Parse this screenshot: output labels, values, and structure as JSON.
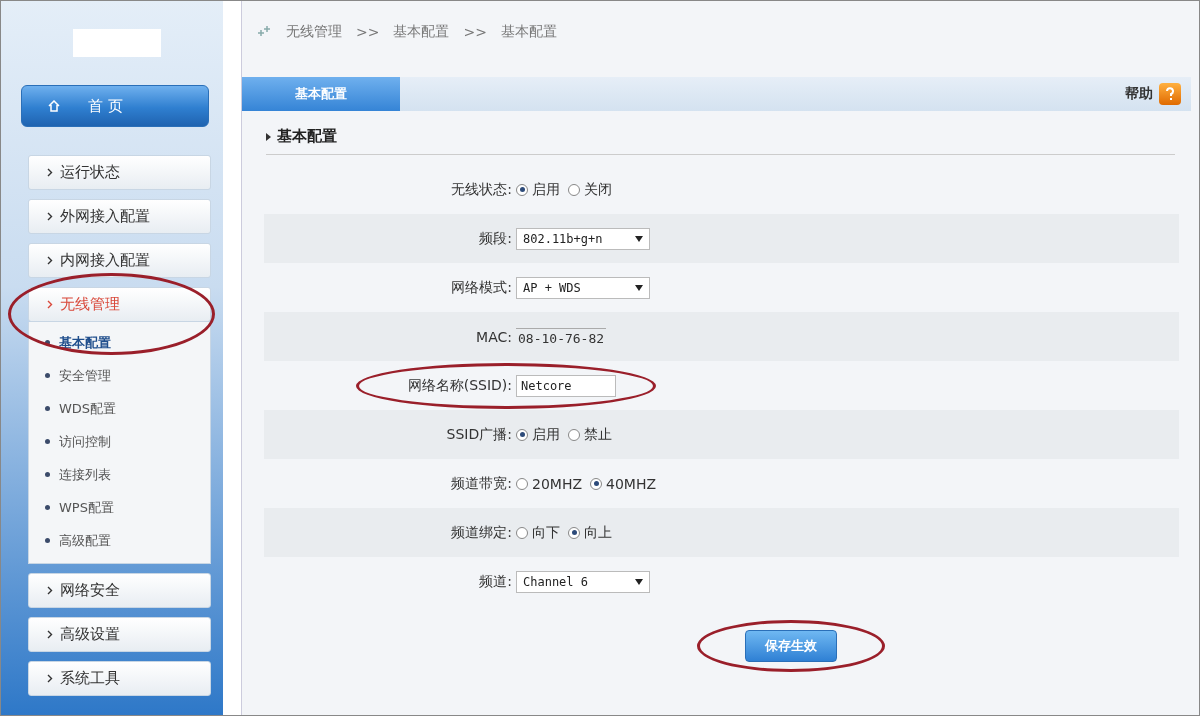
{
  "sidebar": {
    "home": {
      "label": "首 页"
    },
    "items": [
      {
        "label": "运行状态",
        "selected": false
      },
      {
        "label": "外网接入配置",
        "selected": false
      },
      {
        "label": "内网接入配置",
        "selected": false
      },
      {
        "label": "无线管理",
        "selected": true,
        "circled": true,
        "children": [
          {
            "label": "基本配置",
            "selected": true
          },
          {
            "label": "安全管理",
            "selected": false
          },
          {
            "label": "WDS配置",
            "selected": false
          },
          {
            "label": "访问控制",
            "selected": false
          },
          {
            "label": "连接列表",
            "selected": false
          },
          {
            "label": "WPS配置",
            "selected": false
          },
          {
            "label": "高级配置",
            "selected": false
          }
        ]
      },
      {
        "label": "网络安全",
        "selected": false
      },
      {
        "label": "高级设置",
        "selected": false
      },
      {
        "label": "系统工具",
        "selected": false
      }
    ]
  },
  "breadcrumb": {
    "separator": ">>",
    "items": [
      "无线管理",
      "基本配置",
      "基本配置"
    ]
  },
  "tabs": [
    {
      "label": "基本配置",
      "selected": true
    }
  ],
  "help": "帮助",
  "section_title": "基本配置",
  "form": [
    {
      "kind": "radio",
      "label": "无线状态:",
      "options": [
        {
          "label": "启用",
          "selected": true
        },
        {
          "label": "关闭",
          "selected": false
        }
      ]
    },
    {
      "kind": "select",
      "label": "频段:",
      "value": "802.11b+g+n"
    },
    {
      "kind": "select",
      "label": "网络模式:",
      "value": "AP + WDS"
    },
    {
      "kind": "text",
      "label": "MAC:",
      "value": "08-10-76-82"
    },
    {
      "kind": "input",
      "label": "网络名称(SSID):",
      "circled": true,
      "value": "Netcore"
    },
    {
      "kind": "radio",
      "label": "SSID广播:",
      "options": [
        {
          "label": "启用",
          "selected": true
        },
        {
          "label": "禁止",
          "selected": false
        }
      ]
    },
    {
      "kind": "radio",
      "label": "频道带宽:",
      "options": [
        {
          "label": "20MHZ",
          "selected": false
        },
        {
          "label": "40MHZ",
          "selected": true
        }
      ]
    },
    {
      "kind": "radio",
      "label": "频道绑定:",
      "options": [
        {
          "label": "向下",
          "selected": false
        },
        {
          "label": "向上",
          "selected": true
        }
      ]
    },
    {
      "kind": "select",
      "label": "频道:",
      "value": "Channel 6"
    }
  ],
  "save_button": {
    "label": "保存生效",
    "circled": true
  }
}
